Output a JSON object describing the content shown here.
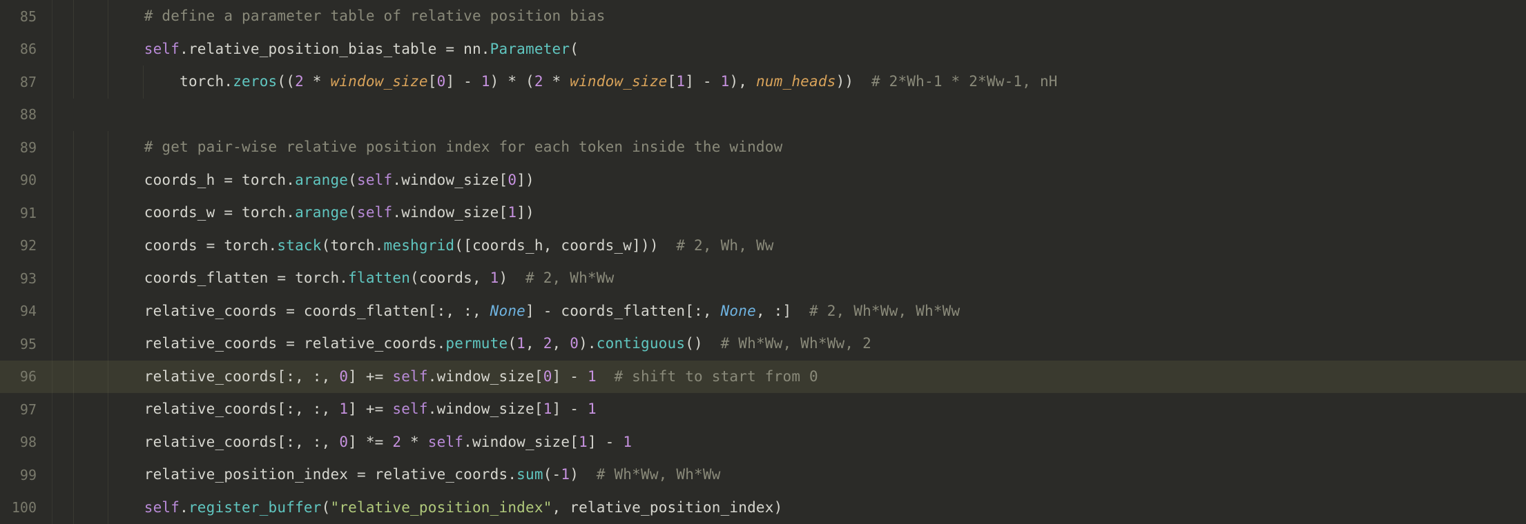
{
  "colors": {
    "background": "#2b2b28",
    "highlight_line_bg": "#3a3a2f",
    "gutter_text": "#7a7a6c",
    "default": "#d6d6cf",
    "comment": "#8a8a7a",
    "self": "#b98bd8",
    "func": "#60c6c0",
    "param_italic": "#d9a35a",
    "number": "#c792e0",
    "keyword_none": "#6fb3e0",
    "string": "#b0c97b"
  },
  "editor": {
    "first_line_number": 85,
    "highlighted_line": 96,
    "indent_unit_chars": 4,
    "base_indent_level": 2,
    "lines": [
      {
        "n": 85,
        "indent": 2,
        "tokens": [
          {
            "cls": "tk-comment",
            "t": "# define a parameter table of relative position bias"
          }
        ]
      },
      {
        "n": 86,
        "indent": 2,
        "tokens": [
          {
            "cls": "tk-self",
            "t": "self"
          },
          {
            "cls": "tk-default",
            "t": ".relative_position_bias_table "
          },
          {
            "cls": "tk-default",
            "t": "= "
          },
          {
            "cls": "tk-ns",
            "t": "nn"
          },
          {
            "cls": "tk-default",
            "t": "."
          },
          {
            "cls": "tk-func",
            "t": "Parameter"
          },
          {
            "cls": "tk-default",
            "t": "("
          }
        ]
      },
      {
        "n": 87,
        "indent": 3,
        "tokens": [
          {
            "cls": "tk-ns",
            "t": "torch"
          },
          {
            "cls": "tk-default",
            "t": "."
          },
          {
            "cls": "tk-func",
            "t": "zeros"
          },
          {
            "cls": "tk-default",
            "t": "(("
          },
          {
            "cls": "tk-num",
            "t": "2"
          },
          {
            "cls": "tk-default",
            "t": " * "
          },
          {
            "cls": "tk-param ital",
            "t": "window_size"
          },
          {
            "cls": "tk-default",
            "t": "["
          },
          {
            "cls": "tk-num",
            "t": "0"
          },
          {
            "cls": "tk-default",
            "t": "] - "
          },
          {
            "cls": "tk-num",
            "t": "1"
          },
          {
            "cls": "tk-default",
            "t": ") * ("
          },
          {
            "cls": "tk-num",
            "t": "2"
          },
          {
            "cls": "tk-default",
            "t": " * "
          },
          {
            "cls": "tk-param ital",
            "t": "window_size"
          },
          {
            "cls": "tk-default",
            "t": "["
          },
          {
            "cls": "tk-num",
            "t": "1"
          },
          {
            "cls": "tk-default",
            "t": "] - "
          },
          {
            "cls": "tk-num",
            "t": "1"
          },
          {
            "cls": "tk-default",
            "t": "), "
          },
          {
            "cls": "tk-param ital",
            "t": "num_heads"
          },
          {
            "cls": "tk-default",
            "t": "))  "
          },
          {
            "cls": "tk-comment",
            "t": "# 2*Wh-1 * 2*Ww-1, nH"
          }
        ]
      },
      {
        "n": 88,
        "indent": 0,
        "tokens": []
      },
      {
        "n": 89,
        "indent": 2,
        "tokens": [
          {
            "cls": "tk-comment",
            "t": "# get pair-wise relative position index for each token inside the window"
          }
        ]
      },
      {
        "n": 90,
        "indent": 2,
        "tokens": [
          {
            "cls": "tk-default",
            "t": "coords_h = torch."
          },
          {
            "cls": "tk-func",
            "t": "arange"
          },
          {
            "cls": "tk-default",
            "t": "("
          },
          {
            "cls": "tk-self",
            "t": "self"
          },
          {
            "cls": "tk-default",
            "t": ".window_size["
          },
          {
            "cls": "tk-num",
            "t": "0"
          },
          {
            "cls": "tk-default",
            "t": "])"
          }
        ]
      },
      {
        "n": 91,
        "indent": 2,
        "tokens": [
          {
            "cls": "tk-default",
            "t": "coords_w = torch."
          },
          {
            "cls": "tk-func",
            "t": "arange"
          },
          {
            "cls": "tk-default",
            "t": "("
          },
          {
            "cls": "tk-self",
            "t": "self"
          },
          {
            "cls": "tk-default",
            "t": ".window_size["
          },
          {
            "cls": "tk-num",
            "t": "1"
          },
          {
            "cls": "tk-default",
            "t": "])"
          }
        ]
      },
      {
        "n": 92,
        "indent": 2,
        "tokens": [
          {
            "cls": "tk-default",
            "t": "coords = torch."
          },
          {
            "cls": "tk-func",
            "t": "stack"
          },
          {
            "cls": "tk-default",
            "t": "(torch."
          },
          {
            "cls": "tk-func",
            "t": "meshgrid"
          },
          {
            "cls": "tk-default",
            "t": "([coords_h, coords_w]))  "
          },
          {
            "cls": "tk-comment",
            "t": "# 2, Wh, Ww"
          }
        ]
      },
      {
        "n": 93,
        "indent": 2,
        "tokens": [
          {
            "cls": "tk-default",
            "t": "coords_flatten = torch."
          },
          {
            "cls": "tk-func",
            "t": "flatten"
          },
          {
            "cls": "tk-default",
            "t": "(coords, "
          },
          {
            "cls": "tk-num",
            "t": "1"
          },
          {
            "cls": "tk-default",
            "t": ")  "
          },
          {
            "cls": "tk-comment",
            "t": "# 2, Wh*Ww"
          }
        ]
      },
      {
        "n": 94,
        "indent": 2,
        "tokens": [
          {
            "cls": "tk-default",
            "t": "relative_coords = coords_flatten[:, :, "
          },
          {
            "cls": "tk-kw italic",
            "t": "None"
          },
          {
            "cls": "tk-default",
            "t": "] - coords_flatten[:, "
          },
          {
            "cls": "tk-kw italic",
            "t": "None"
          },
          {
            "cls": "tk-default",
            "t": ", :]  "
          },
          {
            "cls": "tk-comment",
            "t": "# 2, Wh*Ww, Wh*Ww"
          }
        ]
      },
      {
        "n": 95,
        "indent": 2,
        "tokens": [
          {
            "cls": "tk-default",
            "t": "relative_coords = relative_coords."
          },
          {
            "cls": "tk-func",
            "t": "permute"
          },
          {
            "cls": "tk-default",
            "t": "("
          },
          {
            "cls": "tk-num",
            "t": "1"
          },
          {
            "cls": "tk-default",
            "t": ", "
          },
          {
            "cls": "tk-num",
            "t": "2"
          },
          {
            "cls": "tk-default",
            "t": ", "
          },
          {
            "cls": "tk-num",
            "t": "0"
          },
          {
            "cls": "tk-default",
            "t": ")."
          },
          {
            "cls": "tk-func",
            "t": "contiguous"
          },
          {
            "cls": "tk-default",
            "t": "()  "
          },
          {
            "cls": "tk-comment",
            "t": "# Wh*Ww, Wh*Ww, 2"
          }
        ]
      },
      {
        "n": 96,
        "indent": 2,
        "highlight": true,
        "tokens": [
          {
            "cls": "tk-default",
            "t": "relative_coords[:, :, "
          },
          {
            "cls": "tk-num",
            "t": "0"
          },
          {
            "cls": "tk-default",
            "t": "] += "
          },
          {
            "cls": "tk-self",
            "t": "self"
          },
          {
            "cls": "tk-default",
            "t": ".window_size["
          },
          {
            "cls": "tk-num",
            "t": "0"
          },
          {
            "cls": "tk-default",
            "t": "] - "
          },
          {
            "cls": "tk-num",
            "t": "1"
          },
          {
            "cls": "tk-default",
            "t": "  "
          },
          {
            "cls": "tk-comment",
            "t": "# shift to start from 0"
          }
        ]
      },
      {
        "n": 97,
        "indent": 2,
        "tokens": [
          {
            "cls": "tk-default",
            "t": "relative_coords[:, :, "
          },
          {
            "cls": "tk-num",
            "t": "1"
          },
          {
            "cls": "tk-default",
            "t": "] += "
          },
          {
            "cls": "tk-self",
            "t": "self"
          },
          {
            "cls": "tk-default",
            "t": ".window_size["
          },
          {
            "cls": "tk-num",
            "t": "1"
          },
          {
            "cls": "tk-default",
            "t": "] - "
          },
          {
            "cls": "tk-num",
            "t": "1"
          }
        ]
      },
      {
        "n": 98,
        "indent": 2,
        "tokens": [
          {
            "cls": "tk-default",
            "t": "relative_coords[:, :, "
          },
          {
            "cls": "tk-num",
            "t": "0"
          },
          {
            "cls": "tk-default",
            "t": "] *= "
          },
          {
            "cls": "tk-num",
            "t": "2"
          },
          {
            "cls": "tk-default",
            "t": " * "
          },
          {
            "cls": "tk-self",
            "t": "self"
          },
          {
            "cls": "tk-default",
            "t": ".window_size["
          },
          {
            "cls": "tk-num",
            "t": "1"
          },
          {
            "cls": "tk-default",
            "t": "] - "
          },
          {
            "cls": "tk-num",
            "t": "1"
          }
        ]
      },
      {
        "n": 99,
        "indent": 2,
        "tokens": [
          {
            "cls": "tk-default",
            "t": "relative_position_index = relative_coords."
          },
          {
            "cls": "tk-func",
            "t": "sum"
          },
          {
            "cls": "tk-default",
            "t": "(-"
          },
          {
            "cls": "tk-num",
            "t": "1"
          },
          {
            "cls": "tk-default",
            "t": ")  "
          },
          {
            "cls": "tk-comment",
            "t": "# Wh*Ww, Wh*Ww"
          }
        ]
      },
      {
        "n": 100,
        "indent": 2,
        "tokens": [
          {
            "cls": "tk-self",
            "t": "self"
          },
          {
            "cls": "tk-default",
            "t": "."
          },
          {
            "cls": "tk-func",
            "t": "register_buffer"
          },
          {
            "cls": "tk-default",
            "t": "("
          },
          {
            "cls": "tk-str",
            "t": "\"relative_position_index\""
          },
          {
            "cls": "tk-default",
            "t": ", relative_position_index)"
          }
        ]
      }
    ]
  }
}
